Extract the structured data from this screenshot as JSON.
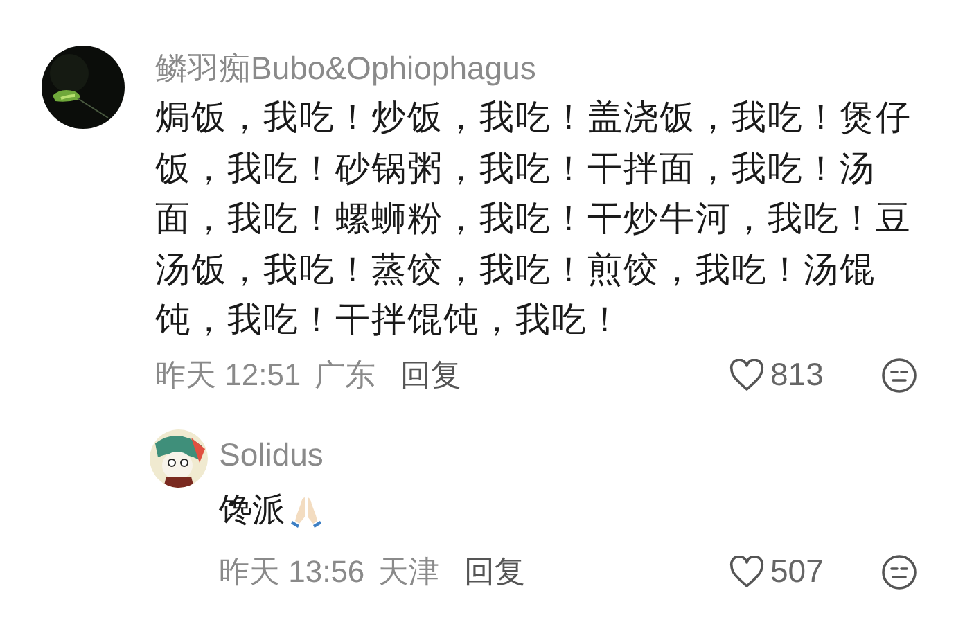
{
  "comment": {
    "author": "鳞羽痴Bubo&Ophiophagus",
    "text": "焗饭，我吃！炒饭，我吃！盖浇饭，我吃！煲仔饭，我吃！砂锅粥，我吃！干拌面，我吃！汤面，我吃！螺蛳粉，我吃！干炒牛河，我吃！豆汤饭，我吃！蒸饺，我吃！煎饺，我吃！汤馄饨，我吃！干拌馄饨，我吃！",
    "time": "昨天 12:51",
    "location": "广东",
    "reply_label": "回复",
    "likes": "813",
    "replies": [
      {
        "author": "Solidus",
        "text": "馋派",
        "time": "昨天 13:56",
        "location": "天津",
        "reply_label": "回复",
        "likes": "507"
      }
    ]
  }
}
